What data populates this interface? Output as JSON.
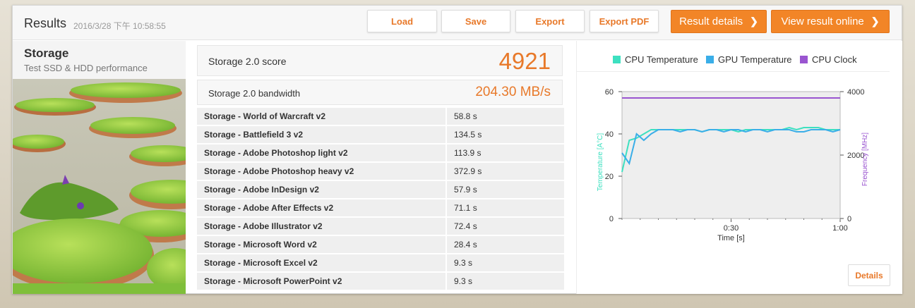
{
  "header": {
    "title": "Results",
    "timestamp": "2016/3/28 下午 10:58:55",
    "buttons": {
      "load": "Load",
      "save": "Save",
      "export": "Export",
      "export_pdf": "Export PDF",
      "result_details": "Result details",
      "view_online": "View result online"
    }
  },
  "test": {
    "name": "Storage",
    "description": "Test SSD & HDD performance"
  },
  "score": {
    "label": "Storage 2.0 score",
    "value": "4921",
    "bandwidth_label": "Storage 2.0 bandwidth",
    "bandwidth_value": "204.30 MB/s"
  },
  "results": [
    {
      "name": "Storage - World of Warcraft v2",
      "value": "58.8 s"
    },
    {
      "name": "Storage - Battlefield 3 v2",
      "value": "134.5 s"
    },
    {
      "name": "Storage - Adobe Photoshop light v2",
      "value": "113.9 s"
    },
    {
      "name": "Storage - Adobe Photoshop heavy v2",
      "value": "372.9 s"
    },
    {
      "name": "Storage - Adobe InDesign v2",
      "value": "57.9 s"
    },
    {
      "name": "Storage - Adobe After Effects v2",
      "value": "71.1 s"
    },
    {
      "name": "Storage - Adobe Illustrator v2",
      "value": "72.4 s"
    },
    {
      "name": "Storage - Microsoft Word v2",
      "value": "28.4 s"
    },
    {
      "name": "Storage - Microsoft Excel v2",
      "value": "9.3 s"
    },
    {
      "name": "Storage - Microsoft PowerPoint v2",
      "value": "9.3 s"
    }
  ],
  "details_label": "Details",
  "colors": {
    "accent": "#e8792a",
    "cpu_temp": "#3de0c0",
    "gpu_temp": "#3aaee8",
    "cpu_clock": "#9a55d0"
  },
  "chart_data": {
    "type": "line",
    "xlabel": "Time [s]",
    "ylabel_left": "Temperature [A°C]",
    "ylabel_right": "Frequency [MHz]",
    "x_ticks": [
      "0:30",
      "1:00"
    ],
    "y_left_ticks": [
      "0",
      "20",
      "40",
      "60"
    ],
    "y_right_ticks": [
      "0",
      "2000",
      "4000"
    ],
    "ylim_left": [
      0,
      60
    ],
    "ylim_right": [
      0,
      4000
    ],
    "xlim": [
      0,
      60
    ],
    "legend": [
      "CPU Temperature",
      "GPU Temperature",
      "CPU Clock"
    ],
    "series": [
      {
        "name": "CPU Temperature",
        "axis": "left",
        "x": [
          0,
          2,
          4,
          6,
          8,
          10,
          12,
          14,
          16,
          18,
          20,
          22,
          24,
          26,
          28,
          30,
          32,
          34,
          36,
          38,
          40,
          42,
          44,
          46,
          48,
          50,
          52,
          54,
          56,
          58,
          60
        ],
        "y": [
          22,
          37,
          38,
          40,
          42,
          42,
          42,
          42,
          42,
          42,
          42,
          41,
          42,
          42,
          42,
          42,
          41,
          42,
          42,
          42,
          42,
          42,
          42,
          43,
          42,
          43,
          43,
          43,
          42,
          42,
          42
        ]
      },
      {
        "name": "GPU Temperature",
        "axis": "left",
        "x": [
          0,
          2,
          4,
          6,
          8,
          10,
          12,
          14,
          16,
          18,
          20,
          22,
          24,
          26,
          28,
          30,
          32,
          34,
          36,
          38,
          40,
          42,
          44,
          46,
          48,
          50,
          52,
          54,
          56,
          58,
          60
        ],
        "y": [
          31,
          26,
          40,
          37,
          40,
          42,
          42,
          42,
          41,
          42,
          42,
          41,
          42,
          42,
          41,
          42,
          42,
          41,
          42,
          42,
          41,
          42,
          42,
          42,
          41,
          41,
          42,
          42,
          42,
          41,
          42
        ]
      },
      {
        "name": "CPU Clock",
        "axis": "right",
        "x": [
          0,
          10,
          20,
          30,
          40,
          50,
          60
        ],
        "y": [
          3800,
          3800,
          3800,
          3800,
          3800,
          3800,
          3800
        ]
      }
    ]
  }
}
